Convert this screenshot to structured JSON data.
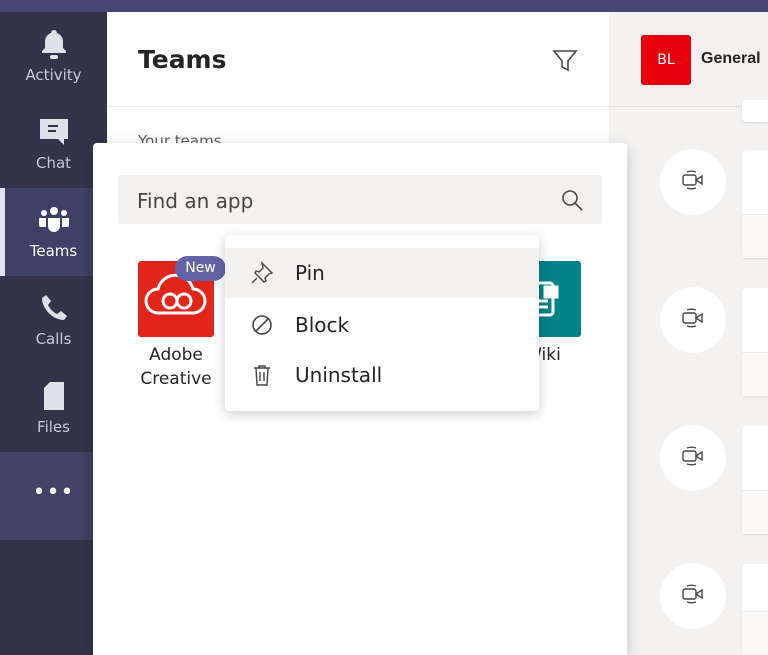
{
  "rail": {
    "items": [
      {
        "label": "Activity"
      },
      {
        "label": "Chat"
      },
      {
        "label": "Teams"
      },
      {
        "label": "Calls"
      },
      {
        "label": "Files"
      }
    ],
    "more_label": "•••"
  },
  "panel": {
    "title": "Teams",
    "section": "Your teams"
  },
  "channel": {
    "avatar": "BL",
    "title": "General"
  },
  "apps_popup": {
    "search_placeholder": "Find an app",
    "apps": [
      {
        "label": "Adobe Creative",
        "line1": "Adobe",
        "line2": "Creative",
        "badge": "New",
        "color": "#e1251b"
      },
      {
        "label": "Wiki",
        "color": "#038387"
      }
    ]
  },
  "context_menu": {
    "items": [
      {
        "label": "Pin",
        "icon": "pin-icon"
      },
      {
        "label": "Block",
        "icon": "block-icon"
      },
      {
        "label": "Uninstall",
        "icon": "trash-icon"
      }
    ]
  },
  "colors": {
    "rail": "#33344a",
    "accent": "#6264a7",
    "topbar": "#464775"
  }
}
